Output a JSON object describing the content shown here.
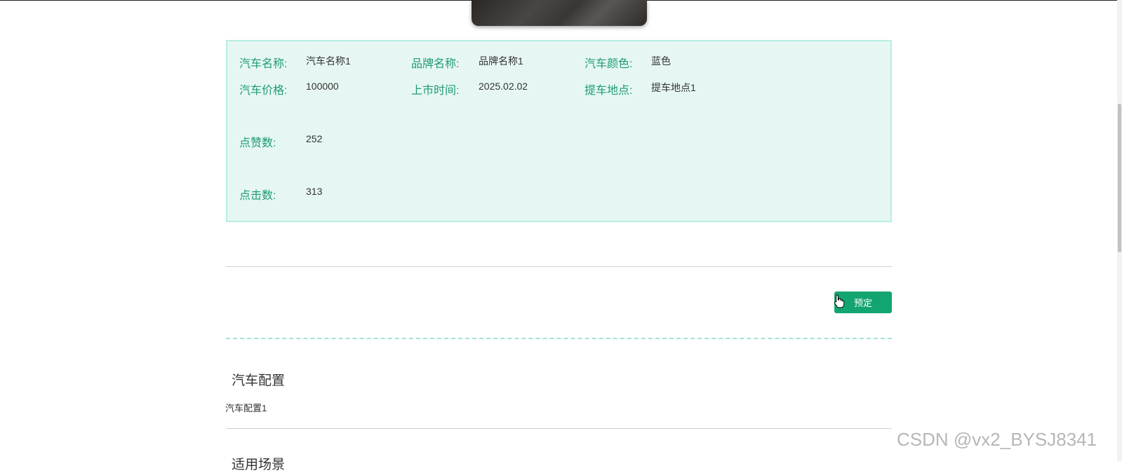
{
  "car_info": {
    "name_label": "汽车名称:",
    "name_value": "汽车名称1",
    "brand_label": "品牌名称:",
    "brand_value": "品牌名称1",
    "color_label": "汽车颜色:",
    "color_value": "蓝色",
    "price_label": "汽车价格:",
    "price_value": "100000",
    "release_label": "上市时间:",
    "release_value": "2025.02.02",
    "pickup_label": "提车地点:",
    "pickup_value": "提车地点1",
    "likes_label": "点赞数:",
    "likes_value": "252",
    "clicks_label": "点击数:",
    "clicks_value": "313"
  },
  "actions": {
    "book_label": "预定"
  },
  "sections": {
    "config_title": "汽车配置",
    "config_body": "汽车配置1",
    "next_title": "适用场景"
  },
  "watermark": "CSDN @vx2_BYSJ8341",
  "colors": {
    "accent": "#12a56f",
    "label_green": "#1e9a73",
    "panel_bg": "#e6f7f3",
    "panel_border": "#b7eee6"
  }
}
